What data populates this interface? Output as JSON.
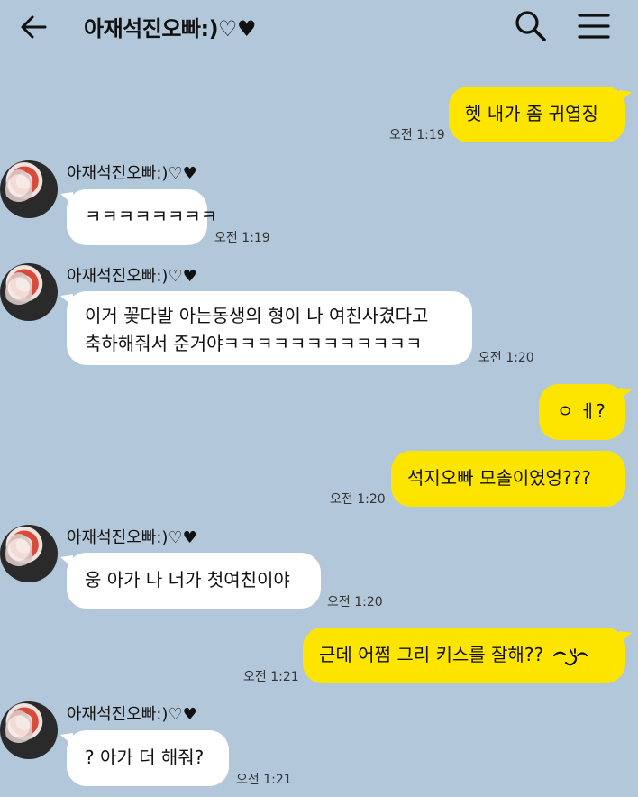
{
  "header": {
    "title": "아재석진오빠:)♡♥",
    "back_icon": "back-arrow-icon",
    "search_icon": "search-icon",
    "menu_icon": "hamburger-menu-icon"
  },
  "colors": {
    "background": "#b2c7da",
    "my_bubble": "#fee500",
    "their_bubble": "#ffffff"
  },
  "messages": [
    {
      "from": "me",
      "text": "헷 내가 좀 귀엽징",
      "time": "오전 1:19"
    },
    {
      "from": "them",
      "sender": "아재석진오빠:)♡♥",
      "text": "ㅋㅋㅋㅋㅋㅋㅋㅋ",
      "time": "오전 1:19"
    },
    {
      "from": "them",
      "sender": "아재석진오빠:)♡♥",
      "line1": "이거 꽃다발 아는동생의 형이 나 여친사겼다고",
      "line2": "축하해줘서 준거야ㅋㅋㅋㅋㅋㅋㅋㅋㅋㅋㅋㅋ",
      "time": "오전 1:20"
    },
    {
      "from": "me",
      "text": "ㅇ ㅔ?"
    },
    {
      "from": "me",
      "text": "석지오빠 모솔이였엉???",
      "time": "오전 1:20"
    },
    {
      "from": "them",
      "sender": "아재석진오빠:)♡♥",
      "text": "웅 아가 나 너가 첫여친이야",
      "time": "오전 1:20"
    },
    {
      "from": "me",
      "text": "근데 어쩜 그리 키스를 잘해??",
      "emoticon": "blush-doodle-icon",
      "time": "오전 1:21"
    },
    {
      "from": "them",
      "sender": "아재석진오빠:)♡♥",
      "text": "? 아가 더 해줘?",
      "time": "오전 1:21"
    }
  ]
}
